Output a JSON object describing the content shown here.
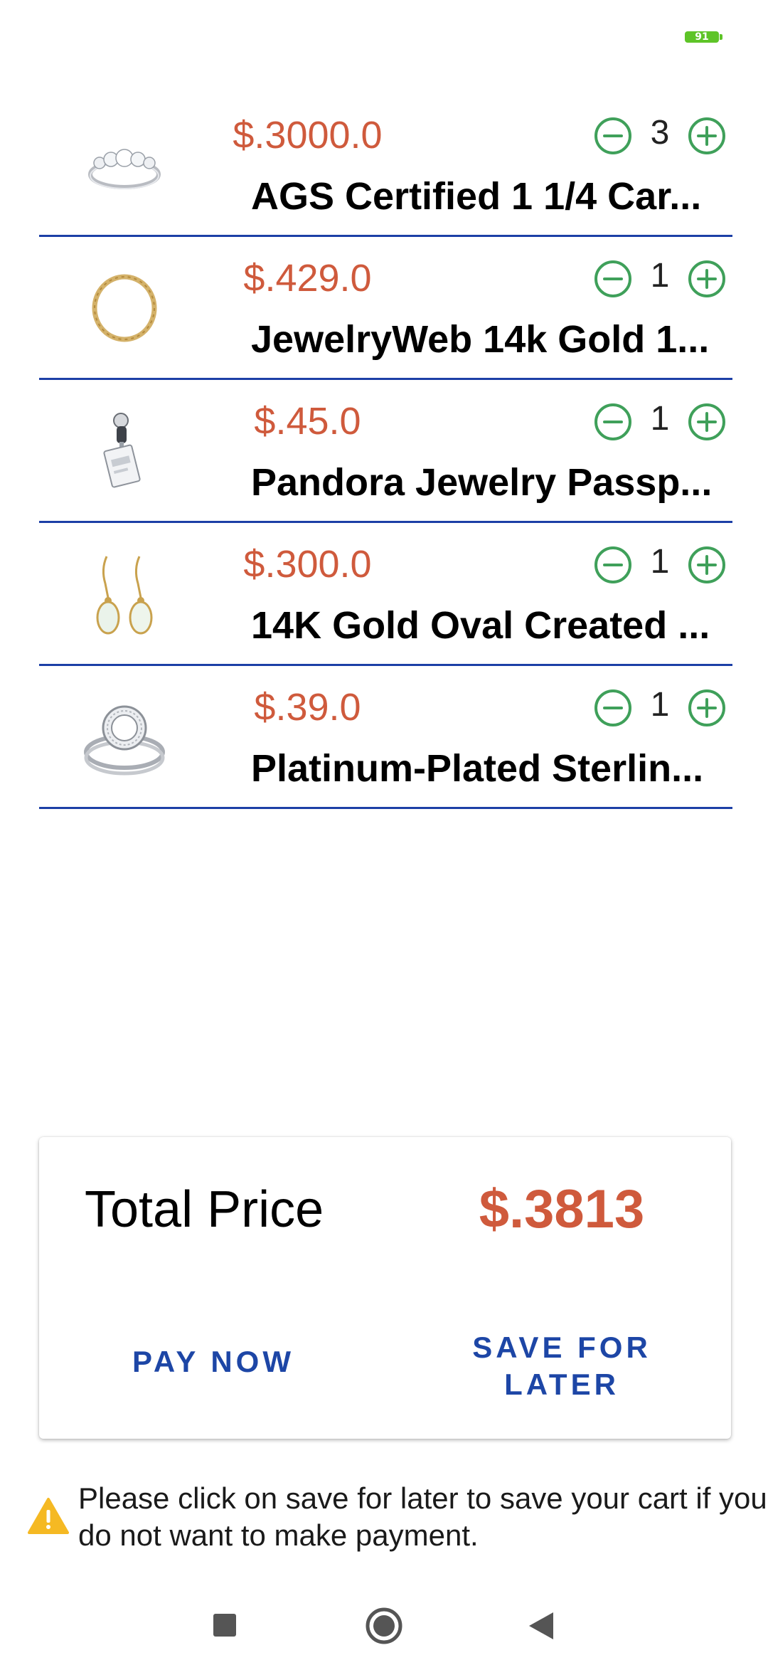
{
  "status_bar": {
    "battery_level": "91",
    "battery_color": "#5ec428"
  },
  "cart": {
    "items": [
      {
        "price": "$.3000.0",
        "name": "AGS Certified 1 1/4 Car...",
        "quantity": "3",
        "thumbnail_icon": "silver-diamond-band-ring"
      },
      {
        "price": "$.429.0",
        "name": "JewelryWeb 14k Gold 1...",
        "quantity": "1",
        "thumbnail_icon": "gold-chain-bracelet"
      },
      {
        "price": "$.45.0",
        "name": "Pandora Jewelry Passp...",
        "quantity": "1",
        "thumbnail_icon": "passport-charm"
      },
      {
        "price": "$.300.0",
        "name": "14K Gold Oval Created ...",
        "quantity": "1",
        "thumbnail_icon": "opal-drop-earrings"
      },
      {
        "price": "$.39.0",
        "name": "Platinum-Plated Sterlin...",
        "quantity": "1",
        "thumbnail_icon": "halo-ring-set"
      }
    ]
  },
  "summary": {
    "total_label": "Total Price",
    "total_value": "$.3813",
    "pay_now_label": "PAY NOW",
    "save_later_label": "SAVE FOR LATER"
  },
  "notice": {
    "text": "Please click on save for later to save your cart if you do not want to make payment.",
    "icon": "warning-icon"
  },
  "nav": {
    "recent_icon": "square-recents-icon",
    "home_icon": "circle-home-icon",
    "back_icon": "triangle-back-icon"
  },
  "colors": {
    "price": "#cf5a3c",
    "divider": "#1c3fa6",
    "qty_button": "#3fa05a",
    "button_text": "#1d46a6",
    "warning": "#f5b923"
  }
}
